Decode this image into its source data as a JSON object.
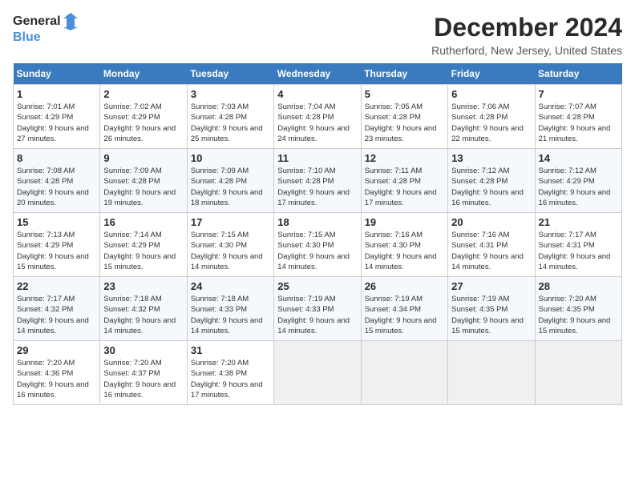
{
  "header": {
    "logo_general": "General",
    "logo_blue": "Blue",
    "month_title": "December 2024",
    "location": "Rutherford, New Jersey, United States"
  },
  "calendar": {
    "days_of_week": [
      "Sunday",
      "Monday",
      "Tuesday",
      "Wednesday",
      "Thursday",
      "Friday",
      "Saturday"
    ],
    "weeks": [
      [
        {
          "day": "1",
          "sunrise": "7:01 AM",
          "sunset": "4:29 PM",
          "daylight": "9 hours and 27 minutes."
        },
        {
          "day": "2",
          "sunrise": "7:02 AM",
          "sunset": "4:29 PM",
          "daylight": "9 hours and 26 minutes."
        },
        {
          "day": "3",
          "sunrise": "7:03 AM",
          "sunset": "4:28 PM",
          "daylight": "9 hours and 25 minutes."
        },
        {
          "day": "4",
          "sunrise": "7:04 AM",
          "sunset": "4:28 PM",
          "daylight": "9 hours and 24 minutes."
        },
        {
          "day": "5",
          "sunrise": "7:05 AM",
          "sunset": "4:28 PM",
          "daylight": "9 hours and 23 minutes."
        },
        {
          "day": "6",
          "sunrise": "7:06 AM",
          "sunset": "4:28 PM",
          "daylight": "9 hours and 22 minutes."
        },
        {
          "day": "7",
          "sunrise": "7:07 AM",
          "sunset": "4:28 PM",
          "daylight": "9 hours and 21 minutes."
        }
      ],
      [
        {
          "day": "8",
          "sunrise": "7:08 AM",
          "sunset": "4:28 PM",
          "daylight": "9 hours and 20 minutes."
        },
        {
          "day": "9",
          "sunrise": "7:09 AM",
          "sunset": "4:28 PM",
          "daylight": "9 hours and 19 minutes."
        },
        {
          "day": "10",
          "sunrise": "7:09 AM",
          "sunset": "4:28 PM",
          "daylight": "9 hours and 18 minutes."
        },
        {
          "day": "11",
          "sunrise": "7:10 AM",
          "sunset": "4:28 PM",
          "daylight": "9 hours and 17 minutes."
        },
        {
          "day": "12",
          "sunrise": "7:11 AM",
          "sunset": "4:28 PM",
          "daylight": "9 hours and 17 minutes."
        },
        {
          "day": "13",
          "sunrise": "7:12 AM",
          "sunset": "4:28 PM",
          "daylight": "9 hours and 16 minutes."
        },
        {
          "day": "14",
          "sunrise": "7:12 AM",
          "sunset": "4:29 PM",
          "daylight": "9 hours and 16 minutes."
        }
      ],
      [
        {
          "day": "15",
          "sunrise": "7:13 AM",
          "sunset": "4:29 PM",
          "daylight": "9 hours and 15 minutes."
        },
        {
          "day": "16",
          "sunrise": "7:14 AM",
          "sunset": "4:29 PM",
          "daylight": "9 hours and 15 minutes."
        },
        {
          "day": "17",
          "sunrise": "7:15 AM",
          "sunset": "4:30 PM",
          "daylight": "9 hours and 14 minutes."
        },
        {
          "day": "18",
          "sunrise": "7:15 AM",
          "sunset": "4:30 PM",
          "daylight": "9 hours and 14 minutes."
        },
        {
          "day": "19",
          "sunrise": "7:16 AM",
          "sunset": "4:30 PM",
          "daylight": "9 hours and 14 minutes."
        },
        {
          "day": "20",
          "sunrise": "7:16 AM",
          "sunset": "4:31 PM",
          "daylight": "9 hours and 14 minutes."
        },
        {
          "day": "21",
          "sunrise": "7:17 AM",
          "sunset": "4:31 PM",
          "daylight": "9 hours and 14 minutes."
        }
      ],
      [
        {
          "day": "22",
          "sunrise": "7:17 AM",
          "sunset": "4:32 PM",
          "daylight": "9 hours and 14 minutes."
        },
        {
          "day": "23",
          "sunrise": "7:18 AM",
          "sunset": "4:32 PM",
          "daylight": "9 hours and 14 minutes."
        },
        {
          "day": "24",
          "sunrise": "7:18 AM",
          "sunset": "4:33 PM",
          "daylight": "9 hours and 14 minutes."
        },
        {
          "day": "25",
          "sunrise": "7:19 AM",
          "sunset": "4:33 PM",
          "daylight": "9 hours and 14 minutes."
        },
        {
          "day": "26",
          "sunrise": "7:19 AM",
          "sunset": "4:34 PM",
          "daylight": "9 hours and 15 minutes."
        },
        {
          "day": "27",
          "sunrise": "7:19 AM",
          "sunset": "4:35 PM",
          "daylight": "9 hours and 15 minutes."
        },
        {
          "day": "28",
          "sunrise": "7:20 AM",
          "sunset": "4:35 PM",
          "daylight": "9 hours and 15 minutes."
        }
      ],
      [
        {
          "day": "29",
          "sunrise": "7:20 AM",
          "sunset": "4:36 PM",
          "daylight": "9 hours and 16 minutes."
        },
        {
          "day": "30",
          "sunrise": "7:20 AM",
          "sunset": "4:37 PM",
          "daylight": "9 hours and 16 minutes."
        },
        {
          "day": "31",
          "sunrise": "7:20 AM",
          "sunset": "4:38 PM",
          "daylight": "9 hours and 17 minutes."
        },
        null,
        null,
        null,
        null
      ]
    ]
  }
}
